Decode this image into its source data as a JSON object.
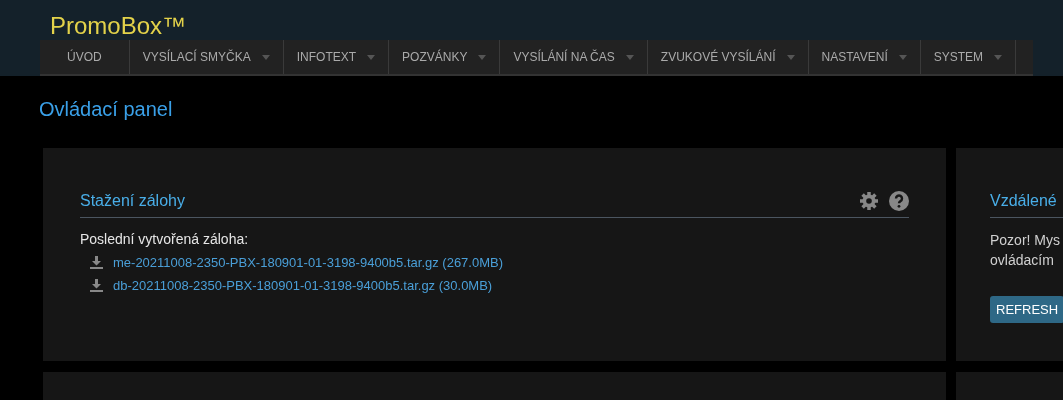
{
  "header": {
    "title": "PromoBox™"
  },
  "nav": [
    {
      "label": "ÚVOD",
      "dropdown": false
    },
    {
      "label": "VYSÍLACÍ SMYČKA",
      "dropdown": true
    },
    {
      "label": "INFOTEXT",
      "dropdown": true
    },
    {
      "label": "POZVÁNKY",
      "dropdown": true
    },
    {
      "label": "VYSÍLÁNÍ NA ČAS",
      "dropdown": true
    },
    {
      "label": "ZVUKOVÉ VYSÍLÁNÍ",
      "dropdown": true
    },
    {
      "label": "NASTAVENÍ",
      "dropdown": true
    },
    {
      "label": "SYSTEM",
      "dropdown": true
    }
  ],
  "page_title": "Ovládací panel",
  "backup_card": {
    "title": "Stažení zálohy",
    "label": "Poslední vytvořená záloha:",
    "files": [
      {
        "name": "me-20211008-2350-PBX-180901-01-3198-9400b5.tar.gz (267.0MB)"
      },
      {
        "name": "db-20211008-2350-PBX-180901-01-3198-9400b5.tar.gz (30.0MB)"
      }
    ]
  },
  "remote_card": {
    "title": "Vzdálené",
    "lines": [
      "Pozor! Mys",
      "ovládacím"
    ],
    "button": "REFRESH"
  }
}
